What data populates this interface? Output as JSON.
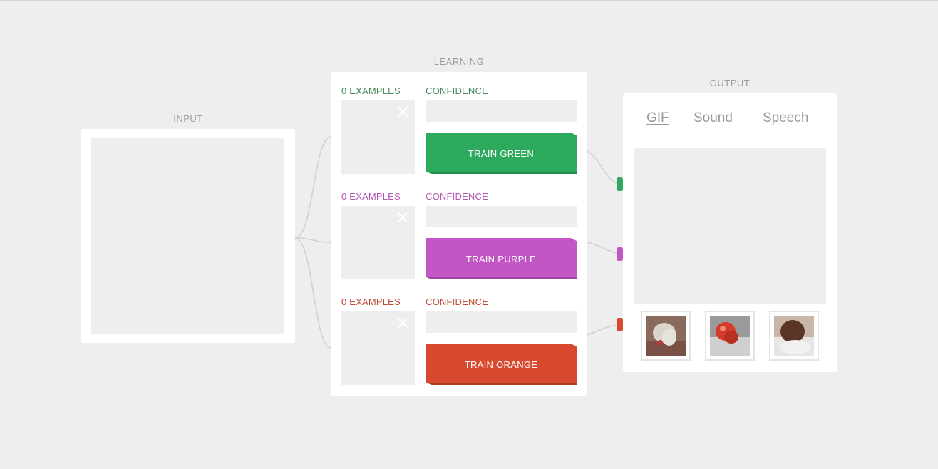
{
  "sections": {
    "input": "INPUT",
    "learning": "LEARNING",
    "output": "OUTPUT"
  },
  "learning_rows": [
    {
      "examples_label": "0 EXAMPLES",
      "confidence_label": "CONFIDENCE",
      "train_label": "TRAIN GREEN",
      "color": "#2daa5e",
      "label_color": "#4a8a5a"
    },
    {
      "examples_label": "0 EXAMPLES",
      "confidence_label": "CONFIDENCE",
      "train_label": "TRAIN PURPLE",
      "color": "#c356c5",
      "label_color": "#b357b4"
    },
    {
      "examples_label": "0 EXAMPLES",
      "confidence_label": "CONFIDENCE",
      "train_label": "TRAIN ORANGE",
      "color": "#d74a2f",
      "label_color": "#c04a34"
    }
  ],
  "output": {
    "tabs": [
      {
        "label": "GIF",
        "active": true
      },
      {
        "label": "Sound",
        "active": false
      },
      {
        "label": "Speech",
        "active": false
      }
    ],
    "thumbnails": [
      "gif-thumbnail-1",
      "gif-thumbnail-2",
      "gif-thumbnail-3"
    ]
  },
  "colors": {
    "green": "#2daa5e",
    "purple": "#c356c5",
    "orange": "#d74a2f",
    "background": "#eeeeee"
  }
}
